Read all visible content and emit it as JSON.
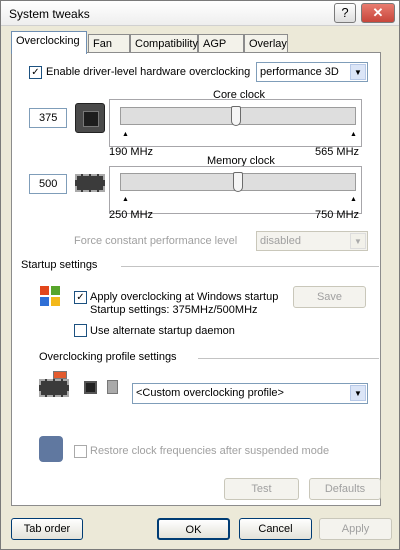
{
  "window": {
    "title": "System tweaks"
  },
  "tabs": [
    "Overclocking",
    "Fan",
    "Compatibility",
    "AGP",
    "Overlay"
  ],
  "driver": {
    "label": "Enable driver-level hardware overclocking",
    "mode": "performance 3D"
  },
  "core": {
    "label": "Core clock",
    "value": "375",
    "min": "190 MHz",
    "max": "565 MHz",
    "level": 0.49
  },
  "memory": {
    "label": "Memory clock",
    "value": "500",
    "min": "250 MHz",
    "max": "750 MHz",
    "level": 0.5
  },
  "perf": {
    "label": "Force constant performance level",
    "value": "disabled"
  },
  "startup": {
    "heading": "Startup settings",
    "apply_label": "Apply overclocking at Windows startup",
    "settings_text": "Startup settings: 375MHz/500MHz",
    "save": "Save",
    "daemon_label": "Use alternate startup daemon"
  },
  "profile": {
    "heading": "Overclocking profile settings",
    "selected": "<Custom overclocking profile>"
  },
  "restore": {
    "label": "Restore clock frequencies after suspended mode"
  },
  "buttons": {
    "test": "Test",
    "defaults": "Defaults",
    "tab_order": "Tab order",
    "ok": "OK",
    "cancel": "Cancel",
    "apply": "Apply"
  }
}
